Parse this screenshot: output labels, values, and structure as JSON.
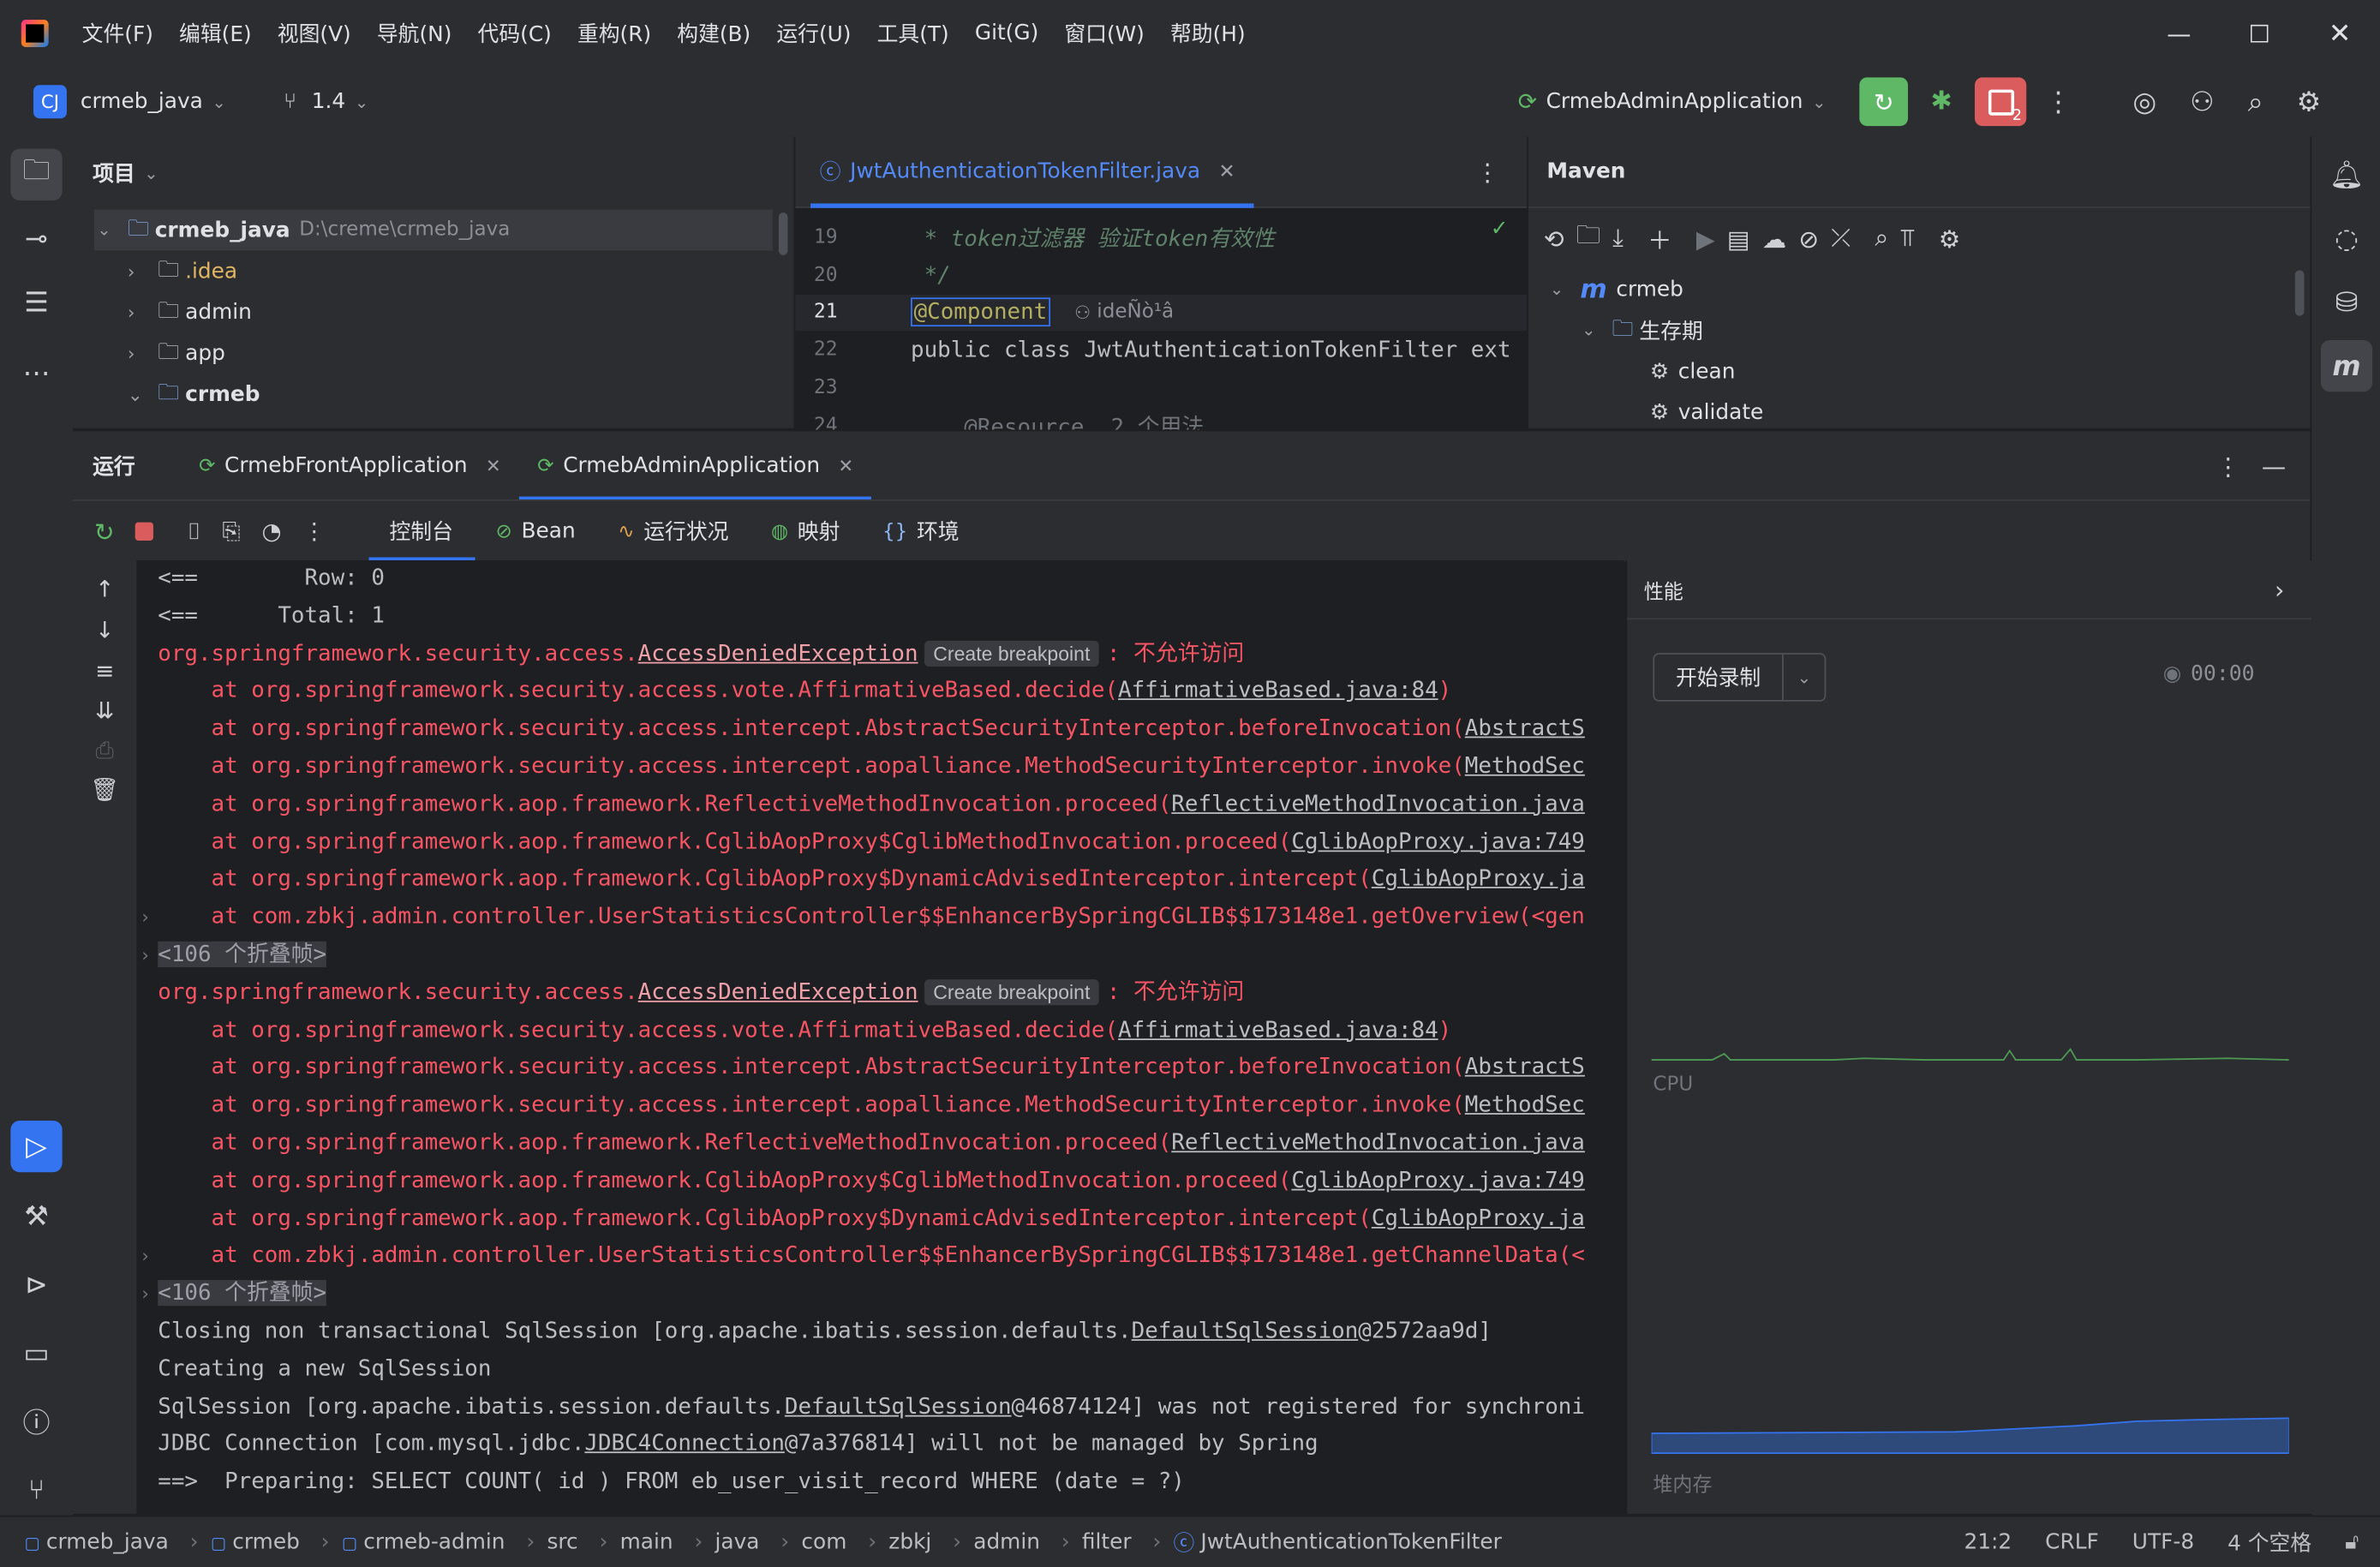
{
  "menu": [
    "文件(F)",
    "编辑(E)",
    "视图(V)",
    "导航(N)",
    "代码(C)",
    "重构(R)",
    "构建(B)",
    "运行(U)",
    "工具(T)",
    "Git(G)",
    "窗口(W)",
    "帮助(H)"
  ],
  "toolbar": {
    "project_badge": "CJ",
    "project_name": "crmeb_java",
    "branch": "1.4",
    "run_config": "CrmebAdminApplication",
    "stop_count": "2"
  },
  "project_panel": {
    "title": "项目",
    "root_name": "crmeb_java",
    "root_path": "D:\\creme\\crmeb_java",
    "items": [
      ".idea",
      "admin",
      "app",
      "crmeb"
    ]
  },
  "editor": {
    "tab": "JwtAuthenticationTokenFilter.java",
    "lines": [
      {
        "num": "19",
        "text": " * token过滤器 验证token有效性"
      },
      {
        "num": "20",
        "text": " */"
      },
      {
        "num": "21",
        "anno": "@Component",
        "author": "ideÑò¹â"
      },
      {
        "num": "22",
        "text": "public class JwtAuthenticationTokenFilter ext"
      },
      {
        "num": "23",
        "text": ""
      },
      {
        "num": "24",
        "text": "    @Resource  2 个用法"
      }
    ]
  },
  "maven": {
    "title": "Maven",
    "root": "crmeb",
    "lifecycle": "生存期",
    "goals": [
      "clean",
      "validate"
    ]
  },
  "run": {
    "title": "运行",
    "tabs": [
      "CrmebFrontApplication",
      "CrmebAdminApplication"
    ],
    "subtabs": [
      "控制台",
      "Bean",
      "运行状况",
      "映射",
      "环境"
    ]
  },
  "console": {
    "breakpoint_label": "Create breakpoint",
    "lines": [
      {
        "kind": "plain",
        "text": "<==        Row: 0"
      },
      {
        "kind": "plain",
        "text": "<==      Total: 1"
      },
      {
        "kind": "exc",
        "pre": "org.springframework.security.access.",
        "link": "AccessDeniedException",
        "msg": ": 不允许访问"
      },
      {
        "kind": "at",
        "pre": "    at org.springframework.security.access.vote.AffirmativeBased.decide(",
        "link": "AffirmativeBased.java:84",
        "post": ")"
      },
      {
        "kind": "at",
        "pre": "    at org.springframework.security.access.intercept.AbstractSecurityInterceptor.beforeInvocation(",
        "link": "AbstractS",
        "post": ""
      },
      {
        "kind": "at",
        "pre": "    at org.springframework.security.access.intercept.aopalliance.MethodSecurityInterceptor.invoke(",
        "link": "MethodSec",
        "post": ""
      },
      {
        "kind": "at",
        "pre": "    at org.springframework.aop.framework.ReflectiveMethodInvocation.proceed(",
        "link": "ReflectiveMethodInvocation.java",
        "post": ""
      },
      {
        "kind": "at",
        "pre": "    at org.springframework.aop.framework.CglibAopProxy$CglibMethodInvocation.proceed(",
        "link": "CglibAopProxy.java:749",
        "post": ""
      },
      {
        "kind": "at",
        "pre": "    at org.springframework.aop.framework.CglibAopProxy$DynamicAdvisedInterceptor.intercept(",
        "link": "CglibAopProxy.ja",
        "post": ""
      },
      {
        "kind": "at2",
        "pre": "    at com.zbkj.admin.controller.UserStatisticsController$$EnhancerBySpringCGLIB$$173148e1.getOverview(<gen",
        "link": "",
        "post": ""
      },
      {
        "kind": "fold",
        "text": "<106 个折叠帧>"
      },
      {
        "kind": "exc",
        "pre": "org.springframework.security.access.",
        "link": "AccessDeniedException",
        "msg": ": 不允许访问"
      },
      {
        "kind": "at",
        "pre": "    at org.springframework.security.access.vote.AffirmativeBased.decide(",
        "link": "AffirmativeBased.java:84",
        "post": ")"
      },
      {
        "kind": "at",
        "pre": "    at org.springframework.security.access.intercept.AbstractSecurityInterceptor.beforeInvocation(",
        "link": "AbstractS",
        "post": ""
      },
      {
        "kind": "at",
        "pre": "    at org.springframework.security.access.intercept.aopalliance.MethodSecurityInterceptor.invoke(",
        "link": "MethodSec",
        "post": ""
      },
      {
        "kind": "at",
        "pre": "    at org.springframework.aop.framework.ReflectiveMethodInvocation.proceed(",
        "link": "ReflectiveMethodInvocation.java",
        "post": ""
      },
      {
        "kind": "at",
        "pre": "    at org.springframework.aop.framework.CglibAopProxy$CglibMethodInvocation.proceed(",
        "link": "CglibAopProxy.java:749",
        "post": ""
      },
      {
        "kind": "at",
        "pre": "    at org.springframework.aop.framework.CglibAopProxy$DynamicAdvisedInterceptor.intercept(",
        "link": "CglibAopProxy.ja",
        "post": ""
      },
      {
        "kind": "at2",
        "pre": "    at com.zbkj.admin.controller.UserStatisticsController$$EnhancerBySpringCGLIB$$173148e1.getChannelData(<",
        "link": "",
        "post": ""
      },
      {
        "kind": "fold",
        "text": "<106 个折叠帧>"
      },
      {
        "kind": "gl",
        "pre": "Closing non transactional SqlSession [org.apache.ibatis.session.defaults.",
        "link": "DefaultSqlSession",
        "post": "@2572aa9d]"
      },
      {
        "kind": "plain",
        "text": "Creating a new SqlSession"
      },
      {
        "kind": "gl",
        "pre": "SqlSession [org.apache.ibatis.session.defaults.",
        "link": "DefaultSqlSession",
        "post": "@46874124] was not registered for synchroni"
      },
      {
        "kind": "gl",
        "pre": "JDBC Connection [com.mysql.jdbc.",
        "link": "JDBC4Connection",
        "post": "@7a376814] will not be managed by Spring"
      },
      {
        "kind": "plain",
        "text": "==>  Preparing: SELECT COUNT( id ) FROM eb_user_visit_record WHERE (date = ?)"
      }
    ]
  },
  "performance": {
    "title": "性能",
    "record_btn": "开始录制",
    "timer": "00:00",
    "cpu_label": "CPU",
    "heap_label": "堆内存"
  },
  "statusbar": {
    "crumbs": [
      "crmeb_java",
      "crmeb",
      "crmeb-admin",
      "src",
      "main",
      "java",
      "com",
      "zbkj",
      "admin",
      "filter",
      "JwtAuthenticationTokenFilter"
    ],
    "position": "21:2",
    "line_sep": "CRLF",
    "encoding": "UTF-8",
    "indent": "4 个空格"
  },
  "colors": {
    "accent": "#3574f0",
    "error": "#f75464",
    "run_green": "#5fb865",
    "stop_red": "#db5c5c"
  }
}
